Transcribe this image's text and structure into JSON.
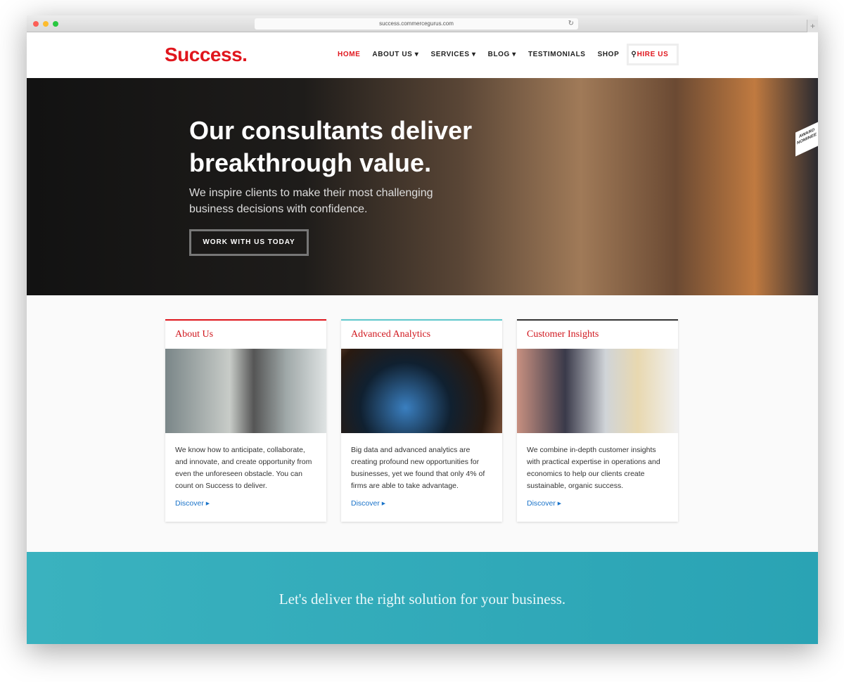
{
  "browser": {
    "url": "success.commercegurus.com"
  },
  "header": {
    "logo": "Success.",
    "nav": [
      {
        "label": "HOME",
        "active": true
      },
      {
        "label": "ABOUT US ▾"
      },
      {
        "label": "SERVICES ▾"
      },
      {
        "label": "BLOG ▾"
      },
      {
        "label": "TESTIMONIALS"
      },
      {
        "label": "SHOP"
      }
    ],
    "search_icon": "search-icon",
    "hire": "HIRE US"
  },
  "hero": {
    "line1": "Our consultants deliver",
    "line2": "breakthrough value.",
    "sub": "We inspire clients to make their most challenging business decisions with confidence.",
    "cta": "WORK WITH US TODAY",
    "badge": "AWARD NOMINEE"
  },
  "cards": [
    {
      "title": "About Us",
      "accent": "#e0161d",
      "text": "We know how to anticipate, collaborate, and innovate, and create opportunity from even the unforeseen obstacle. You can count on Success to deliver.",
      "link": "Discover ▸"
    },
    {
      "title": "Advanced Analytics",
      "accent": "#5fc8cc",
      "text": "Big data and advanced analytics are creating profound new opportunities for businesses, yet we found that only 4% of firms are able to take advantage.",
      "link": "Discover ▸"
    },
    {
      "title": "Customer Insights",
      "accent": "#333333",
      "text": "We combine in-depth customer insights with practical expertise in operations and economics to help our clients create sustainable, organic success.",
      "link": "Discover ▸"
    }
  ],
  "band": {
    "text": "Let's deliver the right solution for your business."
  }
}
